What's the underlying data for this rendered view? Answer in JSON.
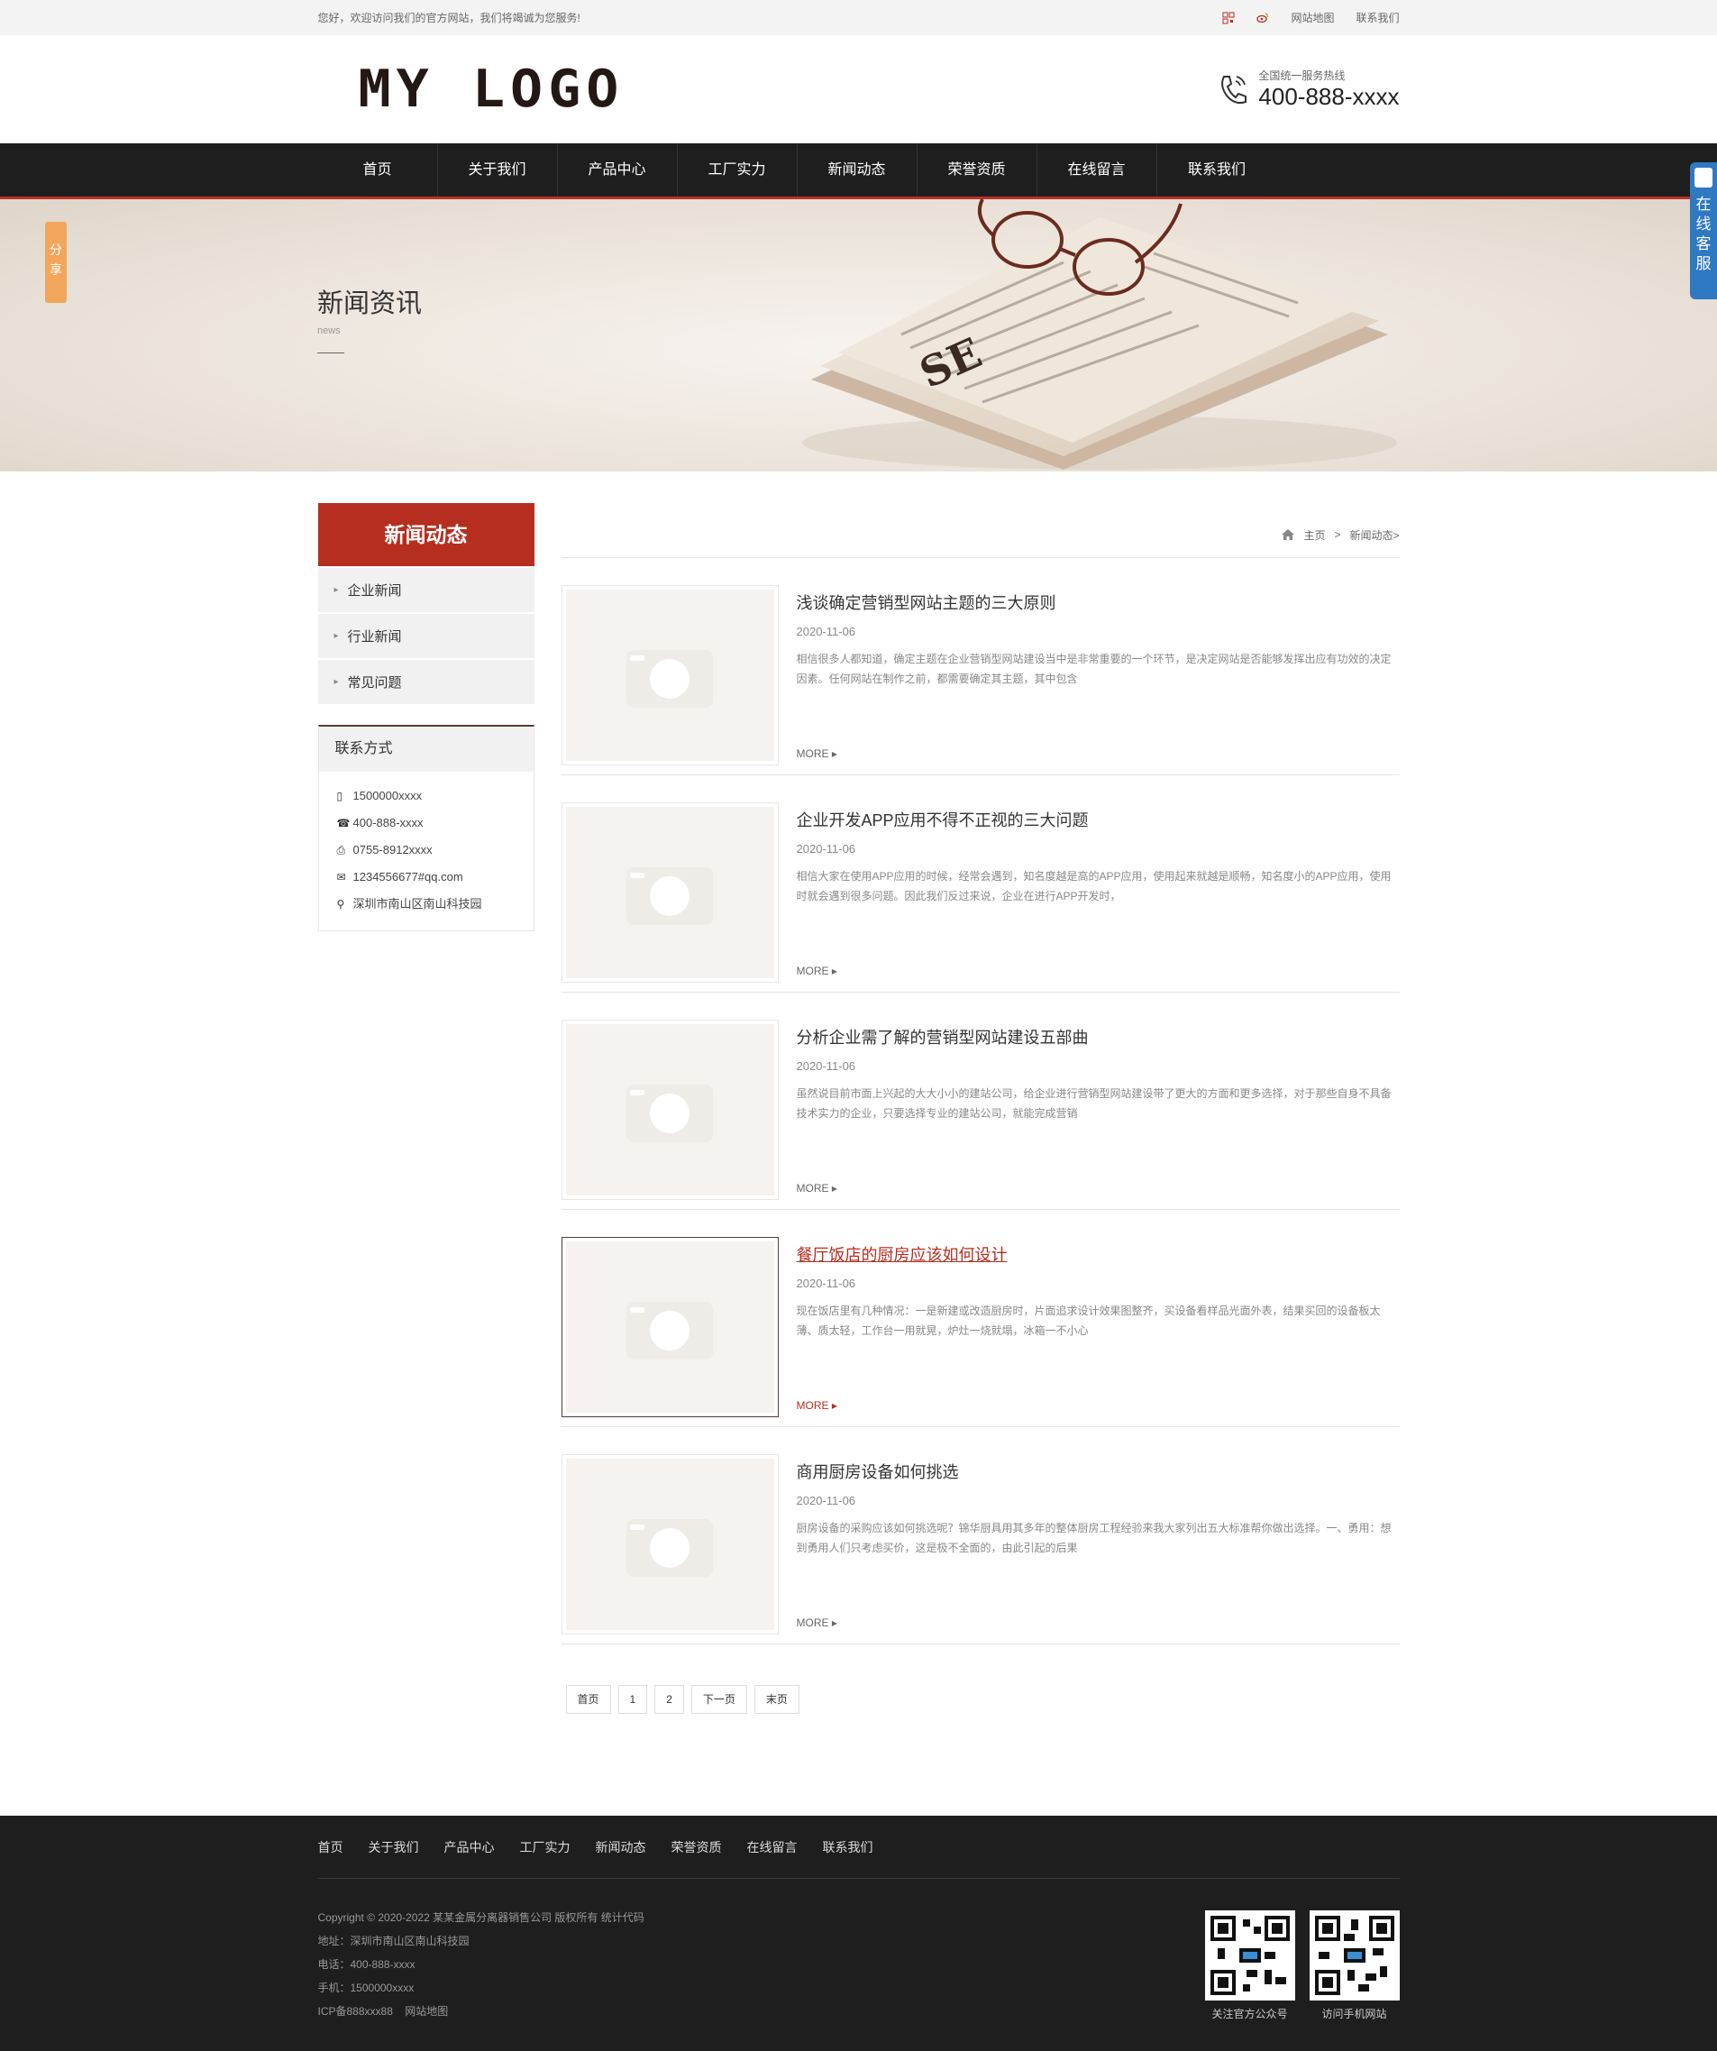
{
  "topbar": {
    "welcome": "您好，欢迎访问我们的官方网站，我们将竭诚为您服务!",
    "sitemap": "网站地图",
    "contact": "联系我们"
  },
  "header": {
    "logo": "MY LOGO",
    "hotline_label": "全国统一服务热线",
    "hotline_number": "400-888-xxxx"
  },
  "nav": [
    "首页",
    "关于我们",
    "产品中心",
    "工厂实力",
    "新闻动态",
    "荣誉资质",
    "在线留言",
    "联系我们"
  ],
  "banner": {
    "title": "新闻资讯",
    "subtitle": "news"
  },
  "sidebar": {
    "title": "新闻动态",
    "items": [
      "企业新闻",
      "行业新闻",
      "常见问题"
    ],
    "contact_title": "联系方式",
    "contact": {
      "mobile": "1500000xxxx",
      "phone": "400-888-xxxx",
      "fax": "0755-8912xxxx",
      "email": "1234556677#qq.com",
      "address": "深圳市南山区南山科技园"
    }
  },
  "breadcrumb": {
    "home": "主页",
    "sep": ">",
    "current": "新闻动态>"
  },
  "news": [
    {
      "title": "浅谈确定营销型网站主题的三大原则",
      "date": "2020-11-06",
      "desc": "相信很多人都知道，确定主题在企业营销型网站建设当中是非常重要的一个环节，是决定网站是否能够发挥出应有功效的决定因素。任何网站在制作之前，都需要确定其主题，其中包含",
      "more": "MORE"
    },
    {
      "title": "企业开发APP应用不得不正视的三大问题",
      "date": "2020-11-06",
      "desc": "相信大家在使用APP应用的时候，经常会遇到，知名度越是高的APP应用，使用起来就越是顺畅，知名度小的APP应用，使用时就会遇到很多问题。因此我们反过来说，企业在进行APP开发时，",
      "more": "MORE"
    },
    {
      "title": "分析企业需了解的营销型网站建设五部曲",
      "date": "2020-11-06",
      "desc": "虽然说目前市面上兴起的大大小小的建站公司，给企业进行营销型网站建设带了更大的方面和更多选择，对于那些自身不具备技术实力的企业，只要选择专业的建站公司，就能完成营销",
      "more": "MORE"
    },
    {
      "title": "餐厅饭店的厨房应该如何设计",
      "date": "2020-11-06",
      "desc": "现在饭店里有几种情况：一是新建或改造厨房时，片面追求设计效果图整齐，买设备看样品光面外表，结果买回的设备板太薄、质太轻，工作台一用就晃，炉灶一烧就塌，冰箱一不小心",
      "more": "MORE"
    },
    {
      "title": "商用厨房设备如何挑选",
      "date": "2020-11-06",
      "desc": "厨房设备的采购应该如何挑选呢？锦华厨具用其多年的整体厨房工程经验来我大家列出五大标准帮你做出选择。一、勇用：想到勇用人们只考虑买价，这是极不全面的，由此引起的后果",
      "more": "MORE"
    }
  ],
  "pager": [
    "首页",
    "1",
    "2",
    "下一页",
    "末页"
  ],
  "footer": {
    "nav": [
      "首页",
      "关于我们",
      "产品中心",
      "工厂实力",
      "新闻动态",
      "荣誉资质",
      "在线留言",
      "联系我们"
    ],
    "copyright": "Copyright © 2020-2022 某某金属分离器销售公司 版权所有 统计代码",
    "address": "地址：深圳市南山区南山科技园",
    "phone": "电话：400-888-xxxx",
    "mobile": "手机：1500000xxxx",
    "icp": "ICP备888xxx88",
    "sitemap": "网站地图",
    "qr1": "关注官方公众号",
    "qr2": "访问手机网站"
  },
  "float": {
    "share": "分享",
    "service": "在线客服"
  },
  "colors": {
    "accent": "#b62e1f",
    "nav_bg": "#1e1e1e",
    "share": "#f1a65c",
    "service": "#2f78c2"
  }
}
